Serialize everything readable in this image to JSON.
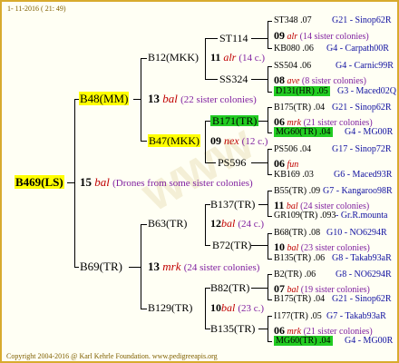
{
  "date": "1- 11-2016 ( 21: 49)",
  "footer": "Copyright 2004-2016 @ Karl Kehrle Foundation.   www.pedigreeapis.org",
  "root": {
    "label": "B469(LS)",
    "count": "15",
    "gen": "bal",
    "desc": "(Drones from some sister colonies)"
  },
  "b48": {
    "label": "B48(MM)",
    "count": "13",
    "gen": "bal",
    "desc": "(22 sister colonies)"
  },
  "b69": {
    "label": "B69(TR)",
    "count": "13",
    "gen": "mrk",
    "desc": "(24 sister colonies)"
  },
  "b12": {
    "label": "B12(MKK)",
    "count": "11",
    "gen": "alr",
    "desc": "(14 c.)"
  },
  "b47": {
    "label": "B47(MKK)",
    "count": "09",
    "gen": "nex",
    "desc": "(12 c.)"
  },
  "b63": {
    "label": "B63(TR)",
    "count": "12",
    "gen": "bal",
    "desc": "(24 c.)"
  },
  "b129": {
    "label": "B129(TR)",
    "count": "10",
    "gen": "bal",
    "desc": "(23 c.)"
  },
  "st114": {
    "label": "ST114"
  },
  "ss324": {
    "label": "SS324"
  },
  "b171": {
    "label": "B171(TR)"
  },
  "ps596": {
    "label": "PS596"
  },
  "b137": {
    "label": "B137(TR)"
  },
  "b72": {
    "label": "B72(TR)"
  },
  "b82": {
    "label": "B82(TR)"
  },
  "b135": {
    "label": "B135(TR)"
  },
  "leaves": [
    {
      "a": "ST348 .07",
      "b": "G21 - Sinop62R"
    },
    {
      "count": "09",
      "gen": "alr",
      "desc": "(14 sister colonies)"
    },
    {
      "a": "KB080 .06",
      "b": "G4 - Carpath00R"
    },
    {
      "a": "SS504 .06",
      "b": "G4 - Carnic99R"
    },
    {
      "count": "08",
      "gen": "ave",
      "desc": "(8 sister colonies)"
    },
    {
      "a": "D131(HR) .05",
      "b": "G3 - Maced02Q"
    },
    {
      "a": "B175(TR) .04",
      "b": "G21 - Sinop62R"
    },
    {
      "count": "06",
      "gen": "mrk",
      "desc": "(21 sister colonies)"
    },
    {
      "a": "MG60(TR) .04",
      "b": "G4 - MG00R"
    },
    {
      "a": "PS506 .04",
      "b": "G17 - Sinop72R"
    },
    {
      "count": "06",
      "gen": "fun",
      "desc": ""
    },
    {
      "a": "KB169 .03",
      "b": "G6 - Maced93R"
    },
    {
      "a": "B55(TR) .09",
      "b": "G7 - Kangaroo98R"
    },
    {
      "count": "11",
      "gen": "bal",
      "desc": "(24 sister colonies)"
    },
    {
      "a": "GR109(TR) .093",
      "b": "- Gr.R.mounta"
    },
    {
      "a": "B68(TR) .08",
      "b": "G10 - NO6294R"
    },
    {
      "count": "10",
      "gen": "bal",
      "desc": "(23 sister colonies)"
    },
    {
      "a": "B135(TR) .06",
      "b": "G8 - Takab93aR"
    },
    {
      "a": "B2(TR) .06",
      "b": "G8 - NO6294R"
    },
    {
      "count": "07",
      "gen": "bal",
      "desc": "(19 sister colonies)"
    },
    {
      "a": "B175(TR) .04",
      "b": "G21 - Sinop62R"
    },
    {
      "a": "I177(TR) .05",
      "b": "G7 - Takab93aR"
    },
    {
      "count": "06",
      "gen": "mrk",
      "desc": "(21 sister colonies)"
    },
    {
      "a": "MG60(TR) .04",
      "b": "G4 - MG00R"
    }
  ],
  "colors": {
    "frame": "#d8ab2e",
    "background": "#fffff4",
    "highlight_yellow": "#ffff00",
    "highlight_green": "#22cc22",
    "gen": "#c00000",
    "link": "#1010a0",
    "desc": "#8020a0"
  }
}
